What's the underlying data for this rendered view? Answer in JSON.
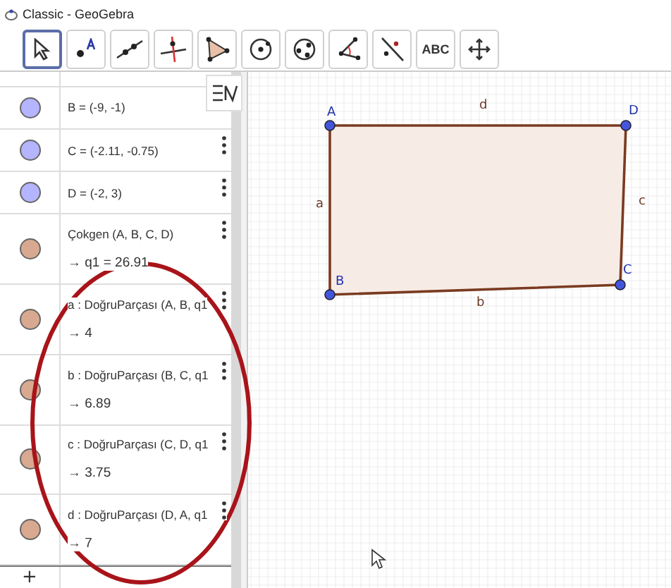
{
  "window": {
    "title": "Classic - GeoGebra"
  },
  "toolbar": [
    {
      "kind": "move",
      "selected": true
    },
    {
      "kind": "point",
      "selected": false
    },
    {
      "kind": "line",
      "selected": false
    },
    {
      "kind": "perpendicular",
      "selected": false
    },
    {
      "kind": "polygon",
      "selected": false
    },
    {
      "kind": "circle",
      "selected": false
    },
    {
      "kind": "conic",
      "selected": false
    },
    {
      "kind": "angle",
      "selected": false
    },
    {
      "kind": "reflect",
      "selected": false
    },
    {
      "kind": "text",
      "label": "ABC",
      "selected": false
    },
    {
      "kind": "pan",
      "selected": false
    }
  ],
  "algebra": {
    "items": [
      {
        "text": "B = (-9, -1)",
        "color": "#b4b4ff",
        "menu": false
      },
      {
        "text": "C = (-2.11, -0.75)",
        "color": "#b4b4ff",
        "menu": true
      },
      {
        "text": "D = (-2, 3)",
        "color": "#b4b4ff",
        "menu": true
      },
      {
        "text": "Çokgen (A, B, C, D)",
        "output": "→  q1 = 26.91",
        "color": "#d8a990",
        "menu": true
      },
      {
        "text": "a : DoğruParçası (A, B, q1",
        "output": "→  4",
        "color": "#d8a990",
        "menu": true
      },
      {
        "text": "b : DoğruParçası (B, C, q1",
        "output": "→  6.89",
        "color": "#d8a990",
        "menu": true
      },
      {
        "text": "c : DoğruParçası (C, D, q1",
        "output": "→  3.75",
        "color": "#d8a990",
        "menu": true
      },
      {
        "text": "d : DoğruParçası (D, A, q1",
        "output": "→  7",
        "color": "#d8a990",
        "menu": true
      }
    ],
    "input_row": {
      "plus": "+"
    }
  },
  "canvas": {
    "points": [
      "A",
      "D",
      "B",
      "C"
    ],
    "segments": [
      "a",
      "b",
      "c",
      "d"
    ]
  }
}
